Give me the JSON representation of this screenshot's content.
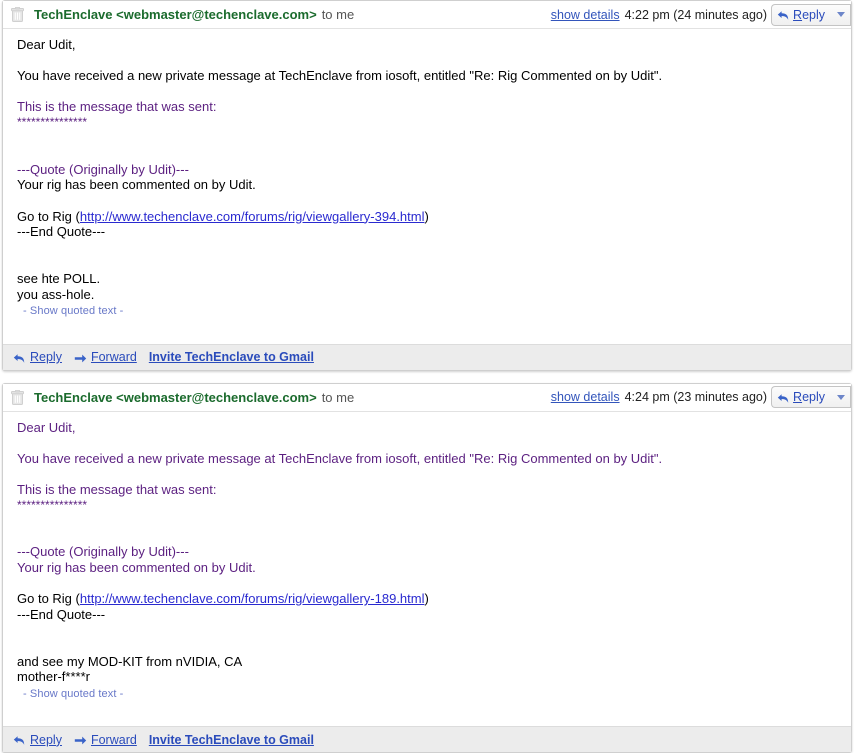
{
  "messages": [
    {
      "trash_icon": "trash-icon",
      "sender": "TechEnclave <webmaster@techenclave.com>",
      "to": "to me",
      "show_details": "show details",
      "timestamp": "4:22 pm (24 minutes ago)",
      "reply_label_prefix": "",
      "reply_label_underlined": "R",
      "reply_label_rest": "eply",
      "reply_icon": "reply-arrow-icon",
      "caret_icon": "chevron-down-icon",
      "body": [
        {
          "text": "Dear Udit,",
          "color": "black"
        },
        {
          "text": "",
          "color": "black"
        },
        {
          "text": "You have received a new private message at TechEnclave from iosoft, entitled \"Re: Rig Commented on by Udit\".",
          "color": "black"
        },
        {
          "text": "",
          "color": "black"
        },
        {
          "text": "This is the message that was sent:",
          "color": "purple"
        },
        {
          "text": "***************",
          "color": "purple"
        },
        {
          "text": "",
          "color": "black"
        },
        {
          "text": "",
          "color": "black"
        },
        {
          "text": "---Quote (Originally by Udit)---",
          "color": "purple"
        },
        {
          "text": "Your rig has been commented on by Udit.",
          "color": "black"
        },
        {
          "text": "",
          "color": "black"
        },
        {
          "text": "Go to Rig (",
          "link": "http://www.techenclave.com/forums/rig/viewgallery-394.html",
          "suffix": ")",
          "color": "black"
        },
        {
          "text": "---End Quote---",
          "color": "black"
        },
        {
          "text": "",
          "color": "black"
        },
        {
          "text": "",
          "color": "black"
        },
        {
          "text": "see hte POLL.",
          "color": "black"
        },
        {
          "text": "you ass-hole.",
          "color": "black"
        }
      ],
      "show_quoted_text": "- Show quoted text -",
      "footer": {
        "reply_icon": "reply-arrow-icon",
        "reply": "Reply",
        "forward_icon": "forward-arrow-icon",
        "forward": "Forward",
        "invite": "Invite TechEnclave to Gmail"
      }
    },
    {
      "trash_icon": "trash-icon",
      "sender": "TechEnclave <webmaster@techenclave.com>",
      "to": "to me",
      "show_details": "show details",
      "timestamp": "4:24 pm (23 minutes ago)",
      "reply_label_prefix": "",
      "reply_label_underlined": "R",
      "reply_label_rest": "eply",
      "reply_icon": "reply-arrow-icon",
      "caret_icon": "chevron-down-icon",
      "body": [
        {
          "text": "Dear Udit,",
          "color": "purple"
        },
        {
          "text": "",
          "color": "black"
        },
        {
          "text": "You have received a new private message at TechEnclave from iosoft, entitled \"Re: Rig Commented on by Udit\".",
          "color": "purple"
        },
        {
          "text": "",
          "color": "black"
        },
        {
          "text": "This is the message that was sent:",
          "color": "purple"
        },
        {
          "text": "***************",
          "color": "purple"
        },
        {
          "text": "",
          "color": "black"
        },
        {
          "text": "",
          "color": "black"
        },
        {
          "text": "---Quote (Originally by Udit)---",
          "color": "purple"
        },
        {
          "text": "Your rig has been commented on by Udit.",
          "color": "purple"
        },
        {
          "text": "",
          "color": "black"
        },
        {
          "text": "Go to Rig (",
          "link": "http://www.techenclave.com/forums/rig/viewgallery-189.html",
          "suffix": ")",
          "color": "black"
        },
        {
          "text": "---End Quote---",
          "color": "black"
        },
        {
          "text": "",
          "color": "black"
        },
        {
          "text": "",
          "color": "black"
        },
        {
          "text": "and see my MOD-KIT from nVIDIA, CA",
          "color": "black"
        },
        {
          "text": "mother-f****r",
          "color": "black"
        }
      ],
      "show_quoted_text": "- Show quoted text -",
      "footer": {
        "reply_icon": "reply-arrow-icon",
        "reply": "Reply",
        "forward_icon": "forward-arrow-icon",
        "forward": "Forward",
        "invite": "Invite TechEnclave to Gmail"
      }
    }
  ],
  "colors": {
    "sender_green": "#1b6b2d",
    "link_blue": "#2a4bbb",
    "quote_purple": "#5b1f80",
    "url_blue": "#2a2ad0",
    "footer_bg": "#ececec"
  }
}
